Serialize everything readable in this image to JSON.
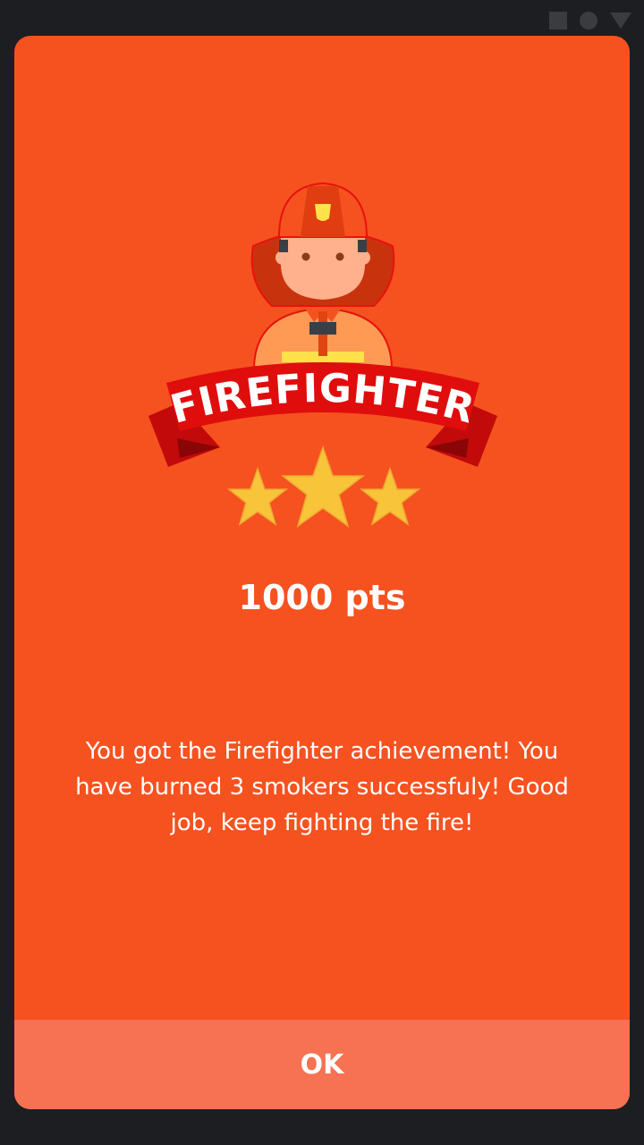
{
  "status_bar": {
    "icons": [
      "square-icon",
      "circle-icon",
      "triangle-icon"
    ]
  },
  "achievement": {
    "badge_title": "FIREFIGHTER",
    "stars": 3,
    "points": "1000 pts",
    "message": "You got the Firefighter achievement! You have burned 3 smokers successfuly! Good job, keep fighting the fire!"
  },
  "dialog": {
    "ok_label": "OK"
  },
  "colors": {
    "background": "#f55220",
    "button": "#f67252",
    "ribbon": "#e00d0d",
    "star": "#f8c43a"
  }
}
